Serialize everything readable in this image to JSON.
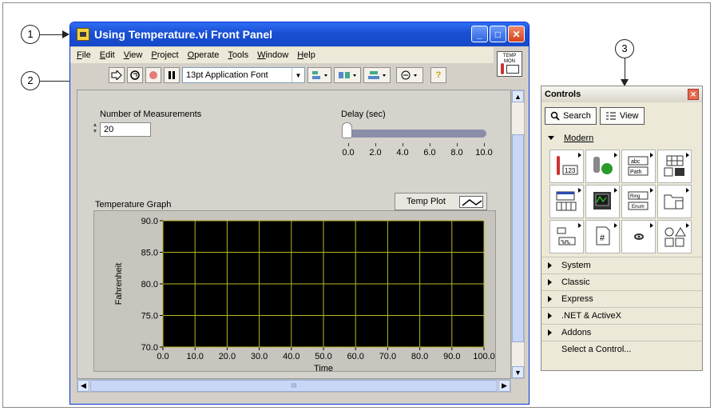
{
  "callouts": {
    "one": "1",
    "two": "2",
    "three": "3"
  },
  "window": {
    "title": "Using Temperature.vi Front Panel",
    "buttons": {
      "minimize": "_",
      "maximize": "□",
      "close": "✕"
    }
  },
  "menu": [
    "File",
    "Edit",
    "View",
    "Project",
    "Operate",
    "Tools",
    "Window",
    "Help"
  ],
  "toolbar": {
    "font": "13pt Application Font",
    "help": "?"
  },
  "vi_icon": {
    "line1": "TEMP",
    "line2": "MON"
  },
  "numeric": {
    "label": "Number of Measurements",
    "value": "20"
  },
  "slider": {
    "label": "Delay (sec)",
    "value": 0.0,
    "ticks": [
      "0.0",
      "2.0",
      "4.0",
      "6.0",
      "8.0",
      "10.0"
    ]
  },
  "graph": {
    "title": "Temperature Graph",
    "legend": "Temp Plot"
  },
  "chart_data": {
    "type": "line",
    "title": "Temperature Graph",
    "xlabel": "Time",
    "ylabel": "Fahrenheit",
    "xlim": [
      0,
      100
    ],
    "ylim": [
      70,
      90
    ],
    "x_ticks": [
      "0.0",
      "10.0",
      "20.0",
      "30.0",
      "40.0",
      "50.0",
      "60.0",
      "70.0",
      "80.0",
      "90.0",
      "100.0"
    ],
    "y_ticks": [
      "70.0",
      "75.0",
      "80.0",
      "85.0",
      "90.0"
    ],
    "grid": true,
    "series": [
      {
        "name": "Temp Plot",
        "values": []
      }
    ],
    "colors": {
      "plot_bg": "#000000",
      "grid": "#b8b820"
    }
  },
  "scrollbar": {
    "thumb": "III"
  },
  "controls": {
    "title": "Controls",
    "search": "Search",
    "view": "View",
    "modern": "Modern",
    "categories": [
      "System",
      "Classic",
      "Express",
      ".NET & ActiveX",
      "Addons"
    ],
    "select": "Select a Control...",
    "palette": [
      "numeric-icon",
      "boolean-icon",
      "string-path-icon",
      "array-matrix-icon",
      "list-table-icon",
      "graph-icon",
      "ring-enum-icon",
      "container-icon",
      "io-icon",
      "refnum-icon",
      "decorations-icon",
      "variant-class-icon"
    ],
    "palette_text": {
      "abc": "abc",
      "path": "Path",
      "num": "123",
      "ring": "Ring",
      "enum": "Enum",
      "hash": "#"
    }
  }
}
